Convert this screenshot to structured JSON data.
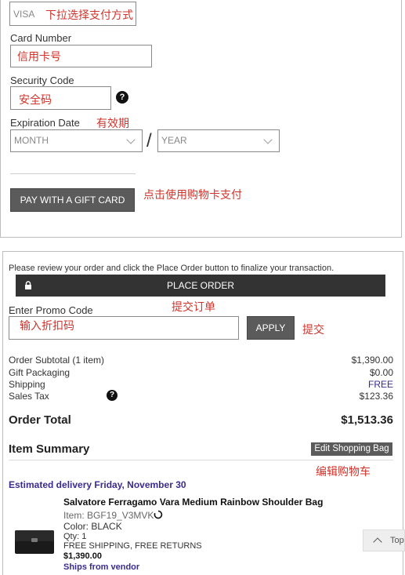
{
  "payment": {
    "method_value": "VISA",
    "method_anno": "下拉选择支付方式",
    "card_number_label": "Card Number",
    "card_number_anno": "信用卡号",
    "security_code_label": "Security Code",
    "security_code_anno": "安全码",
    "help_glyph": "?",
    "expiration_label": "Expiration Date",
    "expiration_anno": "有效期",
    "month_value": "MONTH",
    "separator": "/",
    "year_value": "YEAR",
    "gift_card_button": "PAY WITH A GIFT CARD",
    "gift_card_anno": "点击使用购物卡支付"
  },
  "review": {
    "instruction": "Please review your order and click the Place Order button to finalize your transaction.",
    "place_order_button": "PLACE ORDER",
    "place_order_anno": "提交订单",
    "lock_icon": "lock-icon"
  },
  "promo": {
    "label": "Enter Promo Code",
    "input_anno": "输入折扣码",
    "apply_button": "APPLY",
    "apply_anno": "提交"
  },
  "summary": {
    "rows": [
      {
        "label": "Order Subtotal (1 item)",
        "value": "$1,390.00"
      },
      {
        "label": "Gift Packaging",
        "value": "$0.00"
      },
      {
        "label": "Shipping",
        "value": "FREE"
      },
      {
        "label": "Sales Tax",
        "value": "$123.36"
      }
    ],
    "total_label": "Order Total",
    "total_value": "$1,513.36",
    "free_color": "#3b2a8f"
  },
  "item_summary": {
    "title": "Item Summary",
    "edit_button": "Edit Shopping Bag",
    "edit_anno": "编辑购物车",
    "delivery": "Estimated delivery Friday, November 30",
    "product_name": "Salvatore Ferragamo Vara Medium Rainbow Shoulder Bag",
    "item_no": "Item: BGF19_V3MVK",
    "color": "Color: BLACK",
    "qty": "Qty: 1",
    "shipping": "FREE SHIPPING, FREE RETURNS",
    "price": "$1,390.00",
    "ships_from": "Ships from vendor"
  },
  "top_button": "Top",
  "colors": {
    "annotation": "#d0342c",
    "delivery": "#3b2a8f",
    "dark_bar": "#333333",
    "button": "#5b5b5b"
  }
}
